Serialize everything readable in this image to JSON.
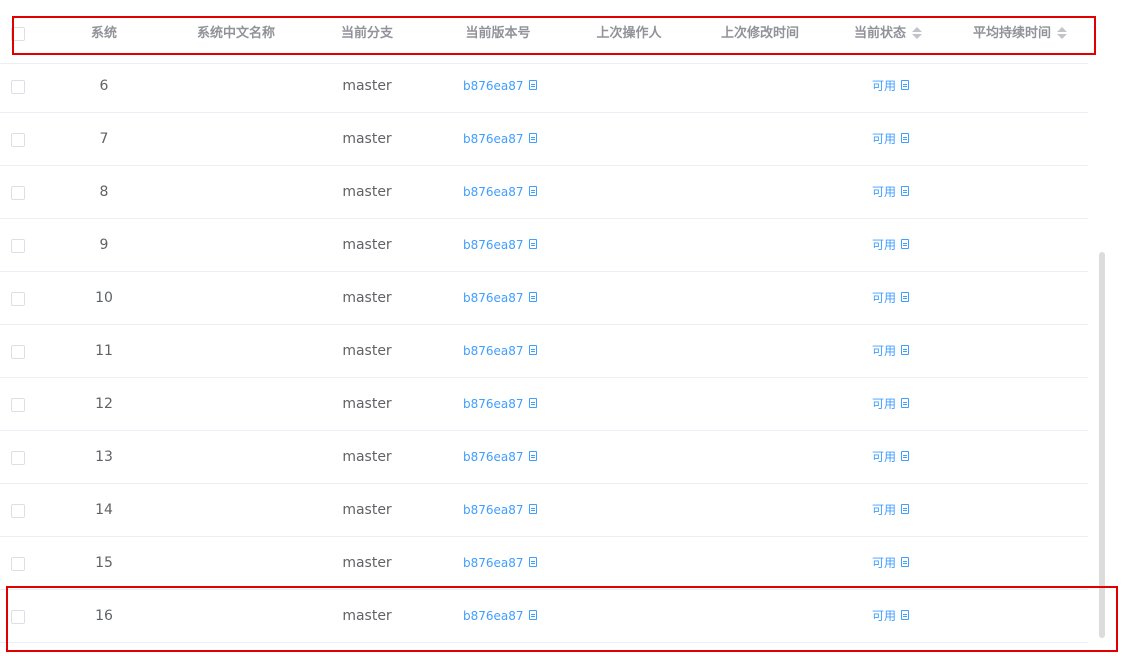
{
  "columns": {
    "system": "系统",
    "cn_name": "系统中文名称",
    "branch": "当前分支",
    "version": "当前版本号",
    "last_operator": "上次操作人",
    "last_modified": "上次修改时间",
    "status": "当前状态",
    "avg_duration": "平均持续时间"
  },
  "rows": [
    {
      "system": "6",
      "cn_name": "",
      "branch": "master",
      "version": "b876ea87",
      "last_operator": "",
      "last_modified": "",
      "status": "可用",
      "avg_duration": ""
    },
    {
      "system": "7",
      "cn_name": "",
      "branch": "master",
      "version": "b876ea87",
      "last_operator": "",
      "last_modified": "",
      "status": "可用",
      "avg_duration": ""
    },
    {
      "system": "8",
      "cn_name": "",
      "branch": "master",
      "version": "b876ea87",
      "last_operator": "",
      "last_modified": "",
      "status": "可用",
      "avg_duration": ""
    },
    {
      "system": "9",
      "cn_name": "",
      "branch": "master",
      "version": "b876ea87",
      "last_operator": "",
      "last_modified": "",
      "status": "可用",
      "avg_duration": ""
    },
    {
      "system": "10",
      "cn_name": "",
      "branch": "master",
      "version": "b876ea87",
      "last_operator": "",
      "last_modified": "",
      "status": "可用",
      "avg_duration": ""
    },
    {
      "system": "11",
      "cn_name": "",
      "branch": "master",
      "version": "b876ea87",
      "last_operator": "",
      "last_modified": "",
      "status": "可用",
      "avg_duration": ""
    },
    {
      "system": "12",
      "cn_name": "",
      "branch": "master",
      "version": "b876ea87",
      "last_operator": "",
      "last_modified": "",
      "status": "可用",
      "avg_duration": ""
    },
    {
      "system": "13",
      "cn_name": "",
      "branch": "master",
      "version": "b876ea87",
      "last_operator": "",
      "last_modified": "",
      "status": "可用",
      "avg_duration": ""
    },
    {
      "system": "14",
      "cn_name": "",
      "branch": "master",
      "version": "b876ea87",
      "last_operator": "",
      "last_modified": "",
      "status": "可用",
      "avg_duration": ""
    },
    {
      "system": "15",
      "cn_name": "",
      "branch": "master",
      "version": "b876ea87",
      "last_operator": "",
      "last_modified": "",
      "status": "可用",
      "avg_duration": ""
    },
    {
      "system": "16",
      "cn_name": "",
      "branch": "master",
      "version": "b876ea87",
      "last_operator": "",
      "last_modified": "",
      "status": "可用",
      "avg_duration": ""
    }
  ],
  "icons": {
    "version_link": "document-icon",
    "status_link": "document-icon",
    "sort": "sort-caret-icon"
  },
  "colors": {
    "link": "#409eff",
    "header_text": "#909399",
    "body_text": "#606266",
    "border": "#ebeef5",
    "highlight": "#e00000"
  }
}
